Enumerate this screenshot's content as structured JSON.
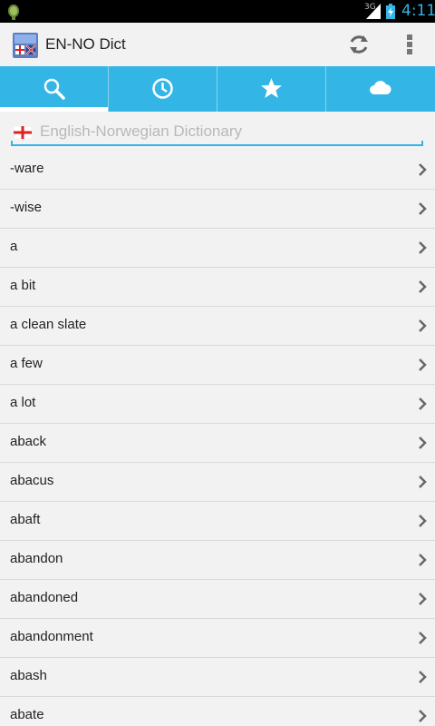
{
  "status_bar": {
    "network": "3G",
    "time": "4:11"
  },
  "action_bar": {
    "title": "EN-NO Dict",
    "actions": [
      "refresh-icon",
      "overflow-menu-icon"
    ]
  },
  "tabs": [
    {
      "icon": "search-icon",
      "selected": true
    },
    {
      "icon": "history-clock-icon",
      "selected": false
    },
    {
      "icon": "favorites-star-icon",
      "selected": false
    },
    {
      "icon": "cloud-icon",
      "selected": false
    }
  ],
  "search": {
    "placeholder": "English-Norwegian Dictionary",
    "value": ""
  },
  "words": [
    "-ware",
    "-wise",
    "a",
    "a bit",
    "a clean slate",
    "a few",
    "a lot",
    "aback",
    "abacus",
    "abaft",
    "abandon",
    "abandoned",
    "abandonment",
    "abash",
    "abate"
  ],
  "colors": {
    "accent": "#33b5e5",
    "background": "#f2f2f2",
    "divider": "#d9d9d9"
  }
}
